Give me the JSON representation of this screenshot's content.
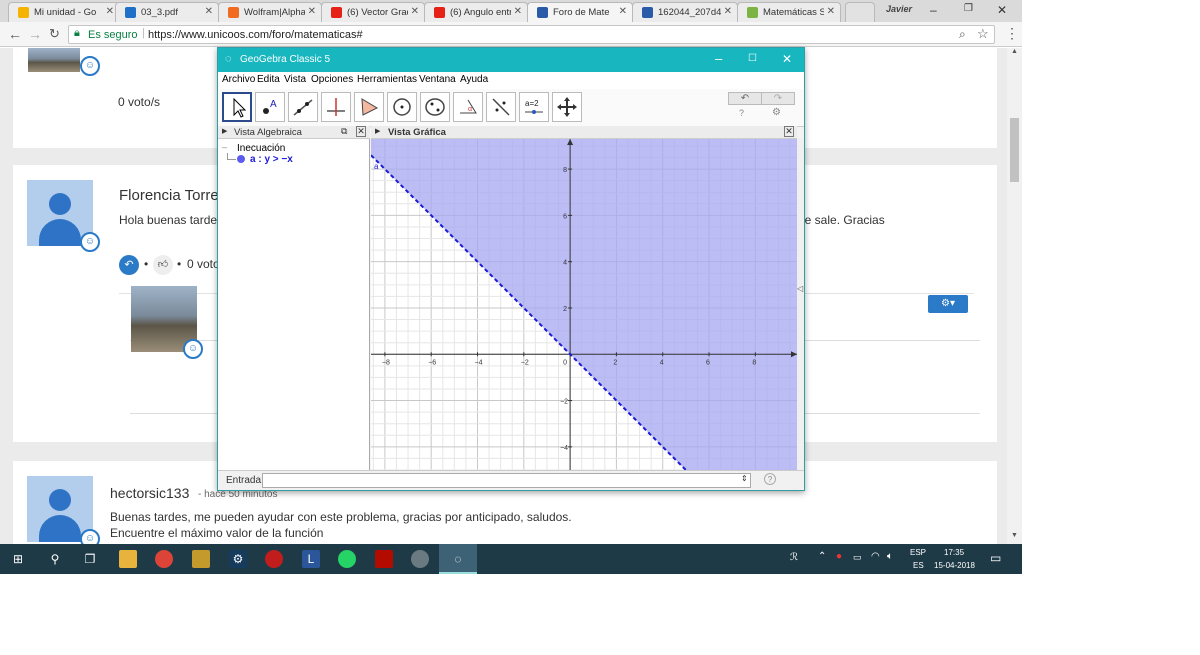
{
  "browser": {
    "tabs": [
      {
        "title": "Mi unidad - Go",
        "fav_color": "#f4b400"
      },
      {
        "title": "03_3.pdf",
        "fav_color": "#1e70c9"
      },
      {
        "title": "Wolfram|Alpha",
        "fav_color": "#f26b21"
      },
      {
        "title": "(6) Vector Grad",
        "fav_color": "#e62117"
      },
      {
        "title": "(6) Angulo entr",
        "fav_color": "#e62117"
      },
      {
        "title": "Foro de Mate",
        "fav_color": "#2a5ba8"
      },
      {
        "title": "162044_207d4",
        "fav_color": "#2a5ba8"
      },
      {
        "title": "Matemáticas S",
        "fav_color": "#7cb342"
      }
    ],
    "user_label": "Javier",
    "secure_label": "Es seguro",
    "url": "https://www.unicoos.com/foro/matematicas#"
  },
  "page": {
    "vote_count_top": "0 voto/s",
    "post1": {
      "author": "Florencia Torre",
      "text_start": "Hola buenas tarde",
      "text_end": "ne sale. Gracias",
      "vote_text": "0 voto"
    },
    "post2": {
      "author": "hectorsic133",
      "time": " - hace 50 minutos",
      "line1": "Buenas tardes, me pueden ayudar con este problema, gracias por anticipado, saludos.",
      "line2": "Encuentre el máximo valor de la función"
    }
  },
  "geogebra": {
    "title": "GeoGebra Classic 5",
    "menu": [
      "Archivo",
      "Edita",
      "Vista",
      "Opciones",
      "Herramientas",
      "Ventana",
      "Ayuda"
    ],
    "algebra_header": "Vista Algebraica",
    "graphics_header": "Vista Gráfica",
    "tree_group": "Inecuación",
    "object_name": "a",
    "object_definition": "a : y > −x",
    "input_label": "Entrada:",
    "colors": {
      "region": "#a7a7f2",
      "boundary": "#1a1ad6",
      "titlebar": "#18b7c0"
    }
  },
  "chart_data": {
    "type": "inequality-region",
    "inequality": "y > -x",
    "boundary": "y = -x (dashed)",
    "label": "a",
    "xlim": [
      -8.6,
      9.8
    ],
    "ylim": [
      -5.0,
      9.3
    ],
    "x_ticks": [
      -8,
      -6,
      -4,
      -2,
      0,
      2,
      4,
      6,
      8
    ],
    "y_ticks": [
      -4,
      -2,
      2,
      4,
      6,
      8
    ],
    "grid": true
  },
  "taskbar": {
    "lang": "ESP",
    "lang2": "ES",
    "time": "17:35",
    "date": "15-04-2018"
  }
}
